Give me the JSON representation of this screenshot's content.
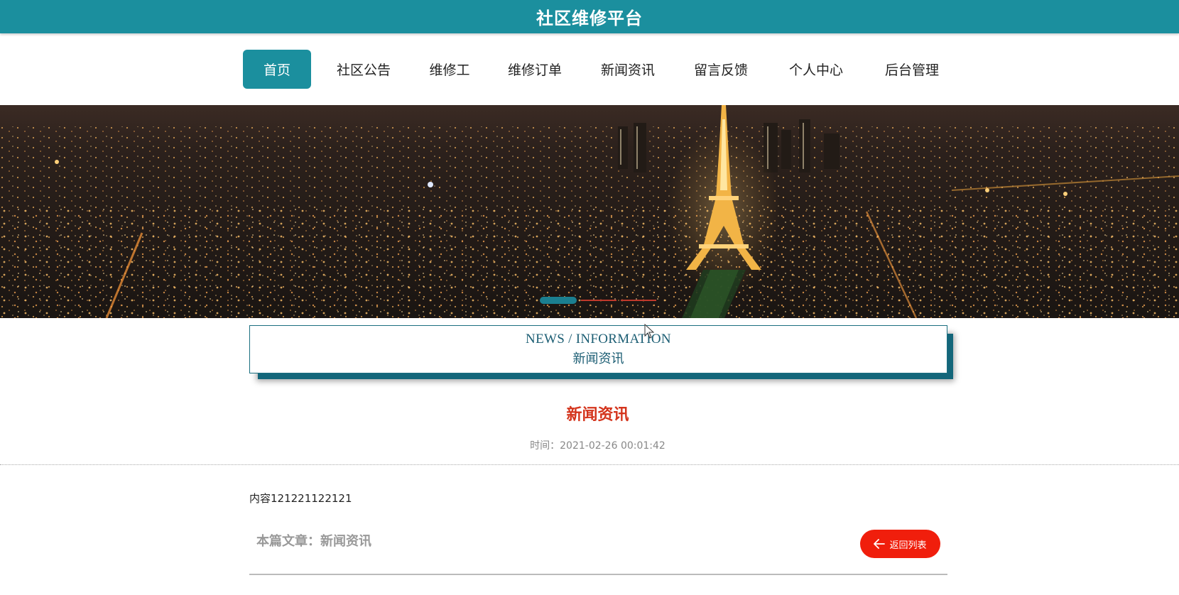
{
  "header": {
    "site_title": "社区维修平台"
  },
  "nav": {
    "items": [
      {
        "label": "首页",
        "active": true
      },
      {
        "label": "社区公告",
        "active": false
      },
      {
        "label": "维修工",
        "active": false
      },
      {
        "label": "维修订单",
        "active": false
      },
      {
        "label": "新闻资讯",
        "active": false
      },
      {
        "label": "留言反馈",
        "active": false
      },
      {
        "label": "个人中心",
        "active": false
      },
      {
        "label": "后台管理",
        "active": false
      }
    ]
  },
  "banner": {
    "slide_count": 3,
    "active_slide": 1
  },
  "section": {
    "title_en": "NEWS / INFORMATION",
    "title_cn": "新闻资讯"
  },
  "article": {
    "title": "新闻资讯",
    "time": "时间：2021-02-26 00:01:42",
    "content": "内容121221122121",
    "source": "本篇文章：新闻资讯"
  },
  "actions": {
    "back_label": "返回列表",
    "back_icon": "arrow-left-icon"
  },
  "colors": {
    "primary": "#1b8f9e",
    "title_red": "#d4341c",
    "button_red": "#f01e0c"
  }
}
